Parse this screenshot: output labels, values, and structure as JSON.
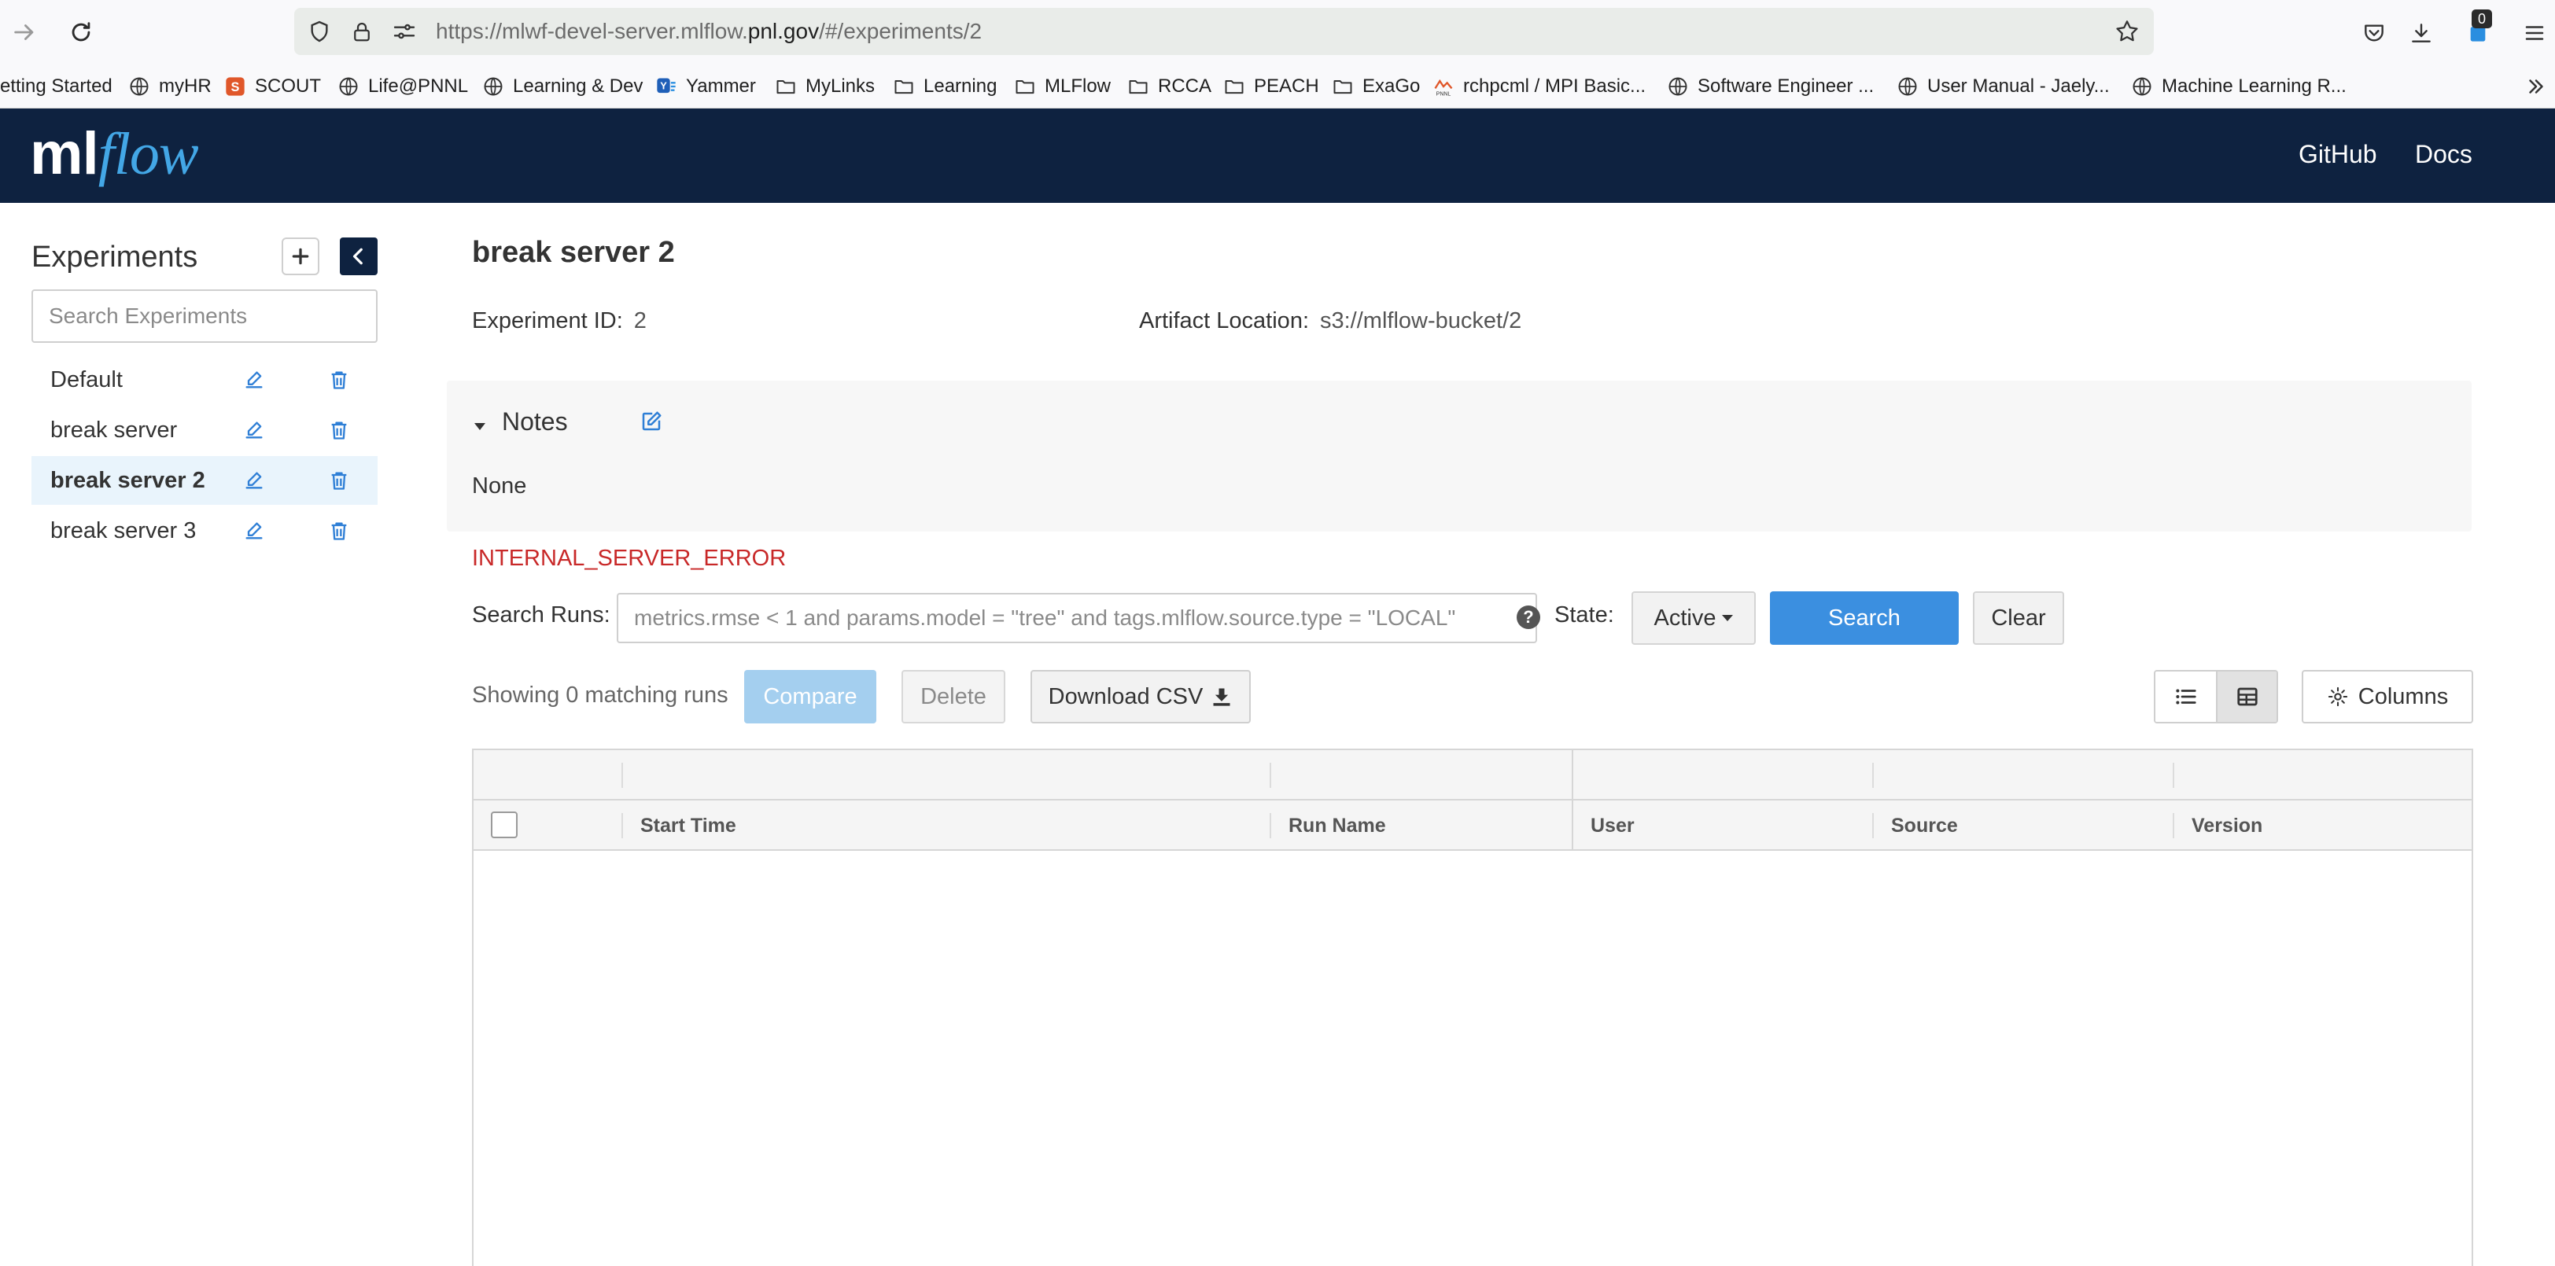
{
  "browser": {
    "url_prefix": "https://mlwf-devel-server.mlflow.",
    "url_domain": "pnl.gov",
    "url_suffix": "/#/experiments/2",
    "notification_count": "0",
    "bookmarks": [
      {
        "label": "etting Started",
        "icon": "firefox-icon"
      },
      {
        "label": "myHR",
        "icon": "globe-icon"
      },
      {
        "label": "SCOUT",
        "icon": "scout-icon"
      },
      {
        "label": "Life@PNNL",
        "icon": "globe-icon"
      },
      {
        "label": "Learning & Dev",
        "icon": "globe-icon"
      },
      {
        "label": "Yammer",
        "icon": "yammer-icon"
      },
      {
        "label": "MyLinks",
        "icon": "folder-icon"
      },
      {
        "label": "Learning",
        "icon": "folder-icon"
      },
      {
        "label": "MLFlow",
        "icon": "folder-icon"
      },
      {
        "label": "RCCA",
        "icon": "folder-icon"
      },
      {
        "label": "PEACH",
        "icon": "folder-icon"
      },
      {
        "label": "ExaGo",
        "icon": "folder-icon"
      },
      {
        "label": "rchpcml / MPI Basic...",
        "icon": "pnnl-icon"
      },
      {
        "label": "Software Engineer ...",
        "icon": "globe-icon"
      },
      {
        "label": "User Manual - Jaely...",
        "icon": "globe-icon"
      },
      {
        "label": "Machine Learning R...",
        "icon": "globe-icon"
      }
    ]
  },
  "header": {
    "logo_ml": "ml",
    "logo_flow": "flow",
    "github": "GitHub",
    "docs": "Docs"
  },
  "sidebar": {
    "title": "Experiments",
    "search_placeholder": "Search Experiments",
    "experiments": [
      {
        "name": "Default",
        "active": false
      },
      {
        "name": "break server",
        "active": false
      },
      {
        "name": "break server 2",
        "active": true
      },
      {
        "name": "break server 3",
        "active": false
      }
    ]
  },
  "experiment": {
    "title": "break server 2",
    "id_label": "Experiment ID:",
    "id_value": "2",
    "artifact_label": "Artifact Location:",
    "artifact_value": "s3://mlflow-bucket/2",
    "notes_label": "Notes",
    "notes_body": "None",
    "error": "INTERNAL_SERVER_ERROR"
  },
  "runs": {
    "search_label": "Search Runs:",
    "search_placeholder": "metrics.rmse < 1 and params.model = \"tree\" and tags.mlflow.source.type = \"LOCAL\"",
    "state_label": "State:",
    "state_value": "Active",
    "search_button": "Search",
    "clear_button": "Clear",
    "showing_text": "Showing 0 matching runs",
    "compare_button": "Compare",
    "delete_button": "Delete",
    "download_button": "Download CSV",
    "columns_button": "Columns",
    "table_headers": [
      "Start Time",
      "Run Name",
      "User",
      "Source",
      "Version"
    ]
  },
  "colors": {
    "header_bg": "#0e2240",
    "accent_blue": "#3b8fe0",
    "error_red": "#c82828",
    "active_row": "#e9f4fc"
  }
}
